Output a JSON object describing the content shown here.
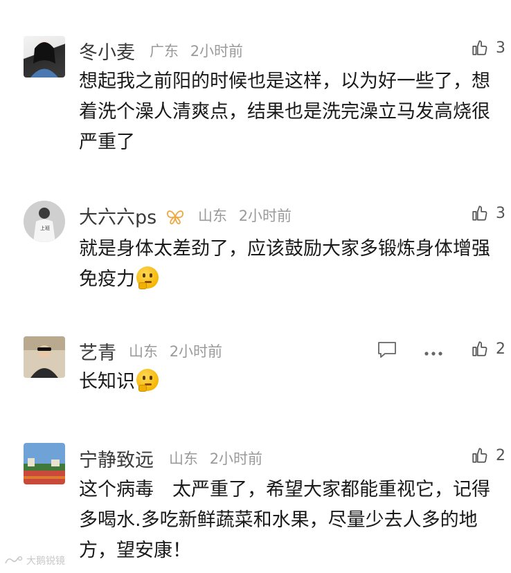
{
  "comments": [
    {
      "name": "冬小麦",
      "location": "广东",
      "time": "2小时前",
      "likes": "3",
      "text": "想起我之前阳的时候也是这样，以为好一些了，想着洗个澡人清爽点，结果也是洗完澡立马发高烧很严重了"
    },
    {
      "name": "大六六ps",
      "location": "山东",
      "time": "2小时前",
      "likes": "3",
      "text": "就是身体太差劲了，应该鼓励大家多锻炼身体增强免疫力",
      "badge_icon": "butterfly-icon",
      "emoji": "shushing-face-emoji"
    },
    {
      "name": "艺青",
      "location": "山东",
      "time": "2小时前",
      "likes": "2",
      "text": "长知识",
      "emoji": "thinking-face-emoji"
    },
    {
      "name": "宁静致远",
      "location": "山东",
      "time": "2小时前",
      "likes": "2",
      "text": "这个病毒　太严重了，希望大家都能重视它，记得多喝水.多吃新鲜蔬菜和水果，尽量少去人多的地方，望安康！"
    }
  ],
  "watermark": "大鹅锐镜",
  "colors": {
    "name": "#3a3a3a",
    "meta": "#9a9a9a",
    "text": "#1a1a1a",
    "badge": "#f0a640"
  }
}
